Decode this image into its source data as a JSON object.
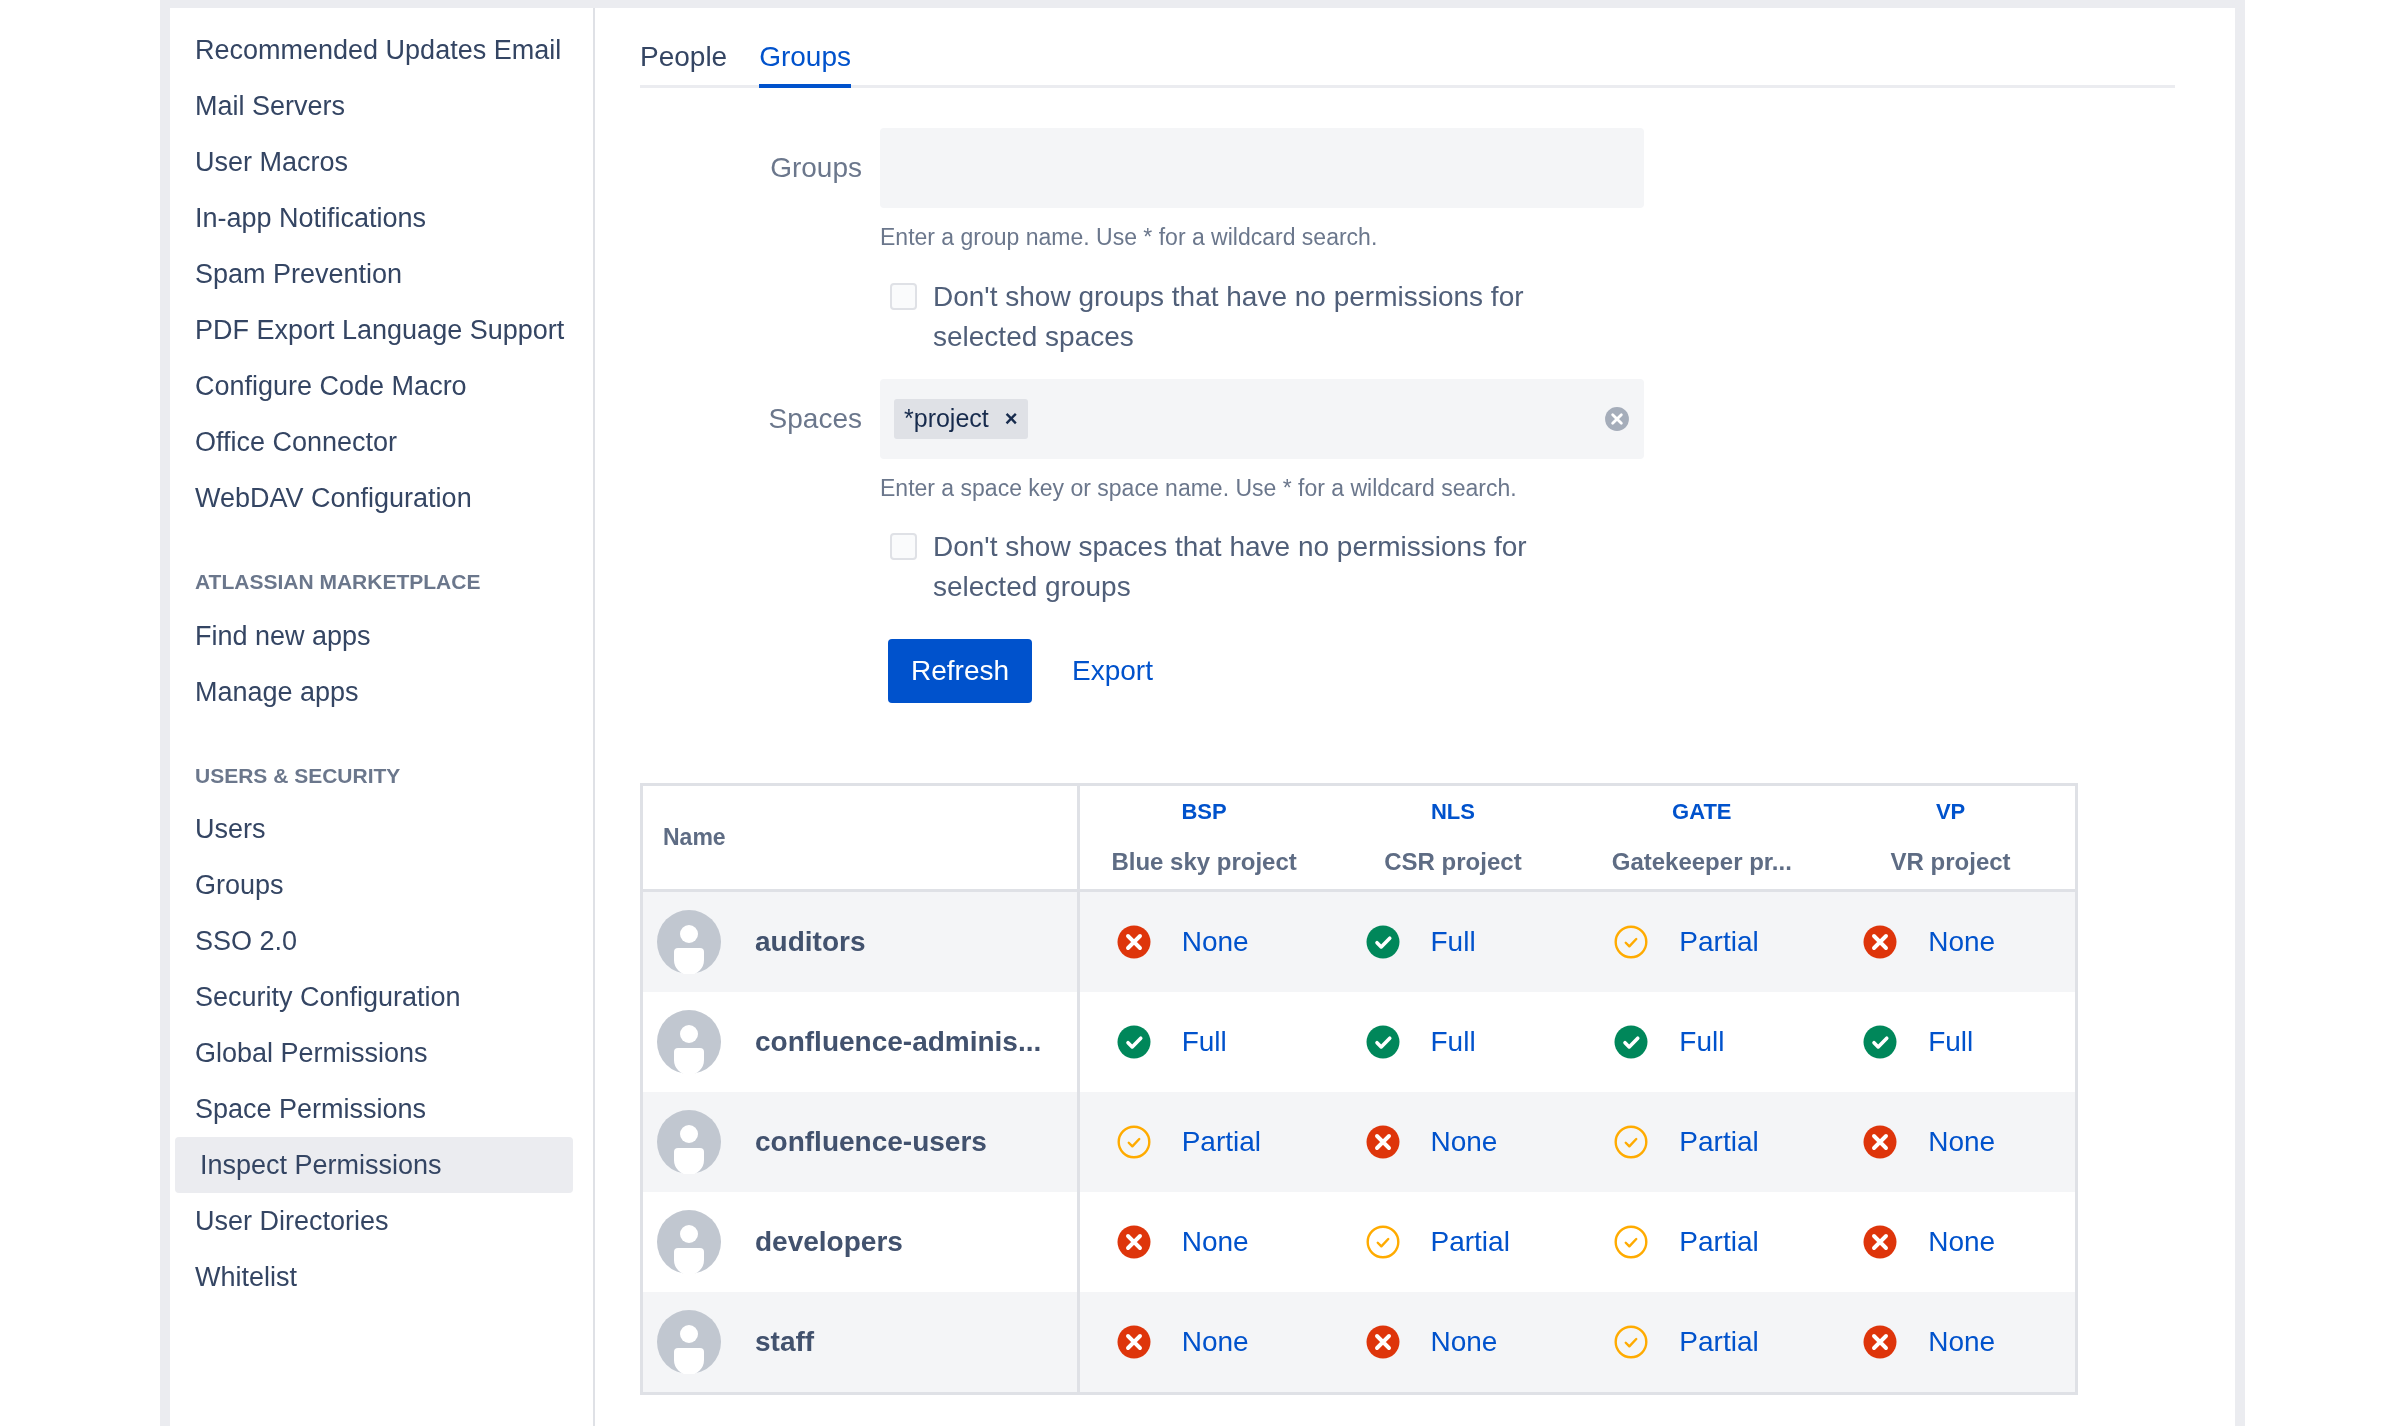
{
  "sidebar": {
    "sections": [
      {
        "items": [
          {
            "label": "Recommended Updates Email",
            "selected": false
          },
          {
            "label": "Mail Servers",
            "selected": false
          },
          {
            "label": "User Macros",
            "selected": false
          },
          {
            "label": "In-app Notifications",
            "selected": false
          },
          {
            "label": "Spam Prevention",
            "selected": false
          },
          {
            "label": "PDF Export Language Support",
            "selected": false
          },
          {
            "label": "Configure Code Macro",
            "selected": false
          },
          {
            "label": "Office Connector",
            "selected": false
          },
          {
            "label": "WebDAV Configuration",
            "selected": false
          }
        ]
      },
      {
        "heading": "ATLASSIAN MARKETPLACE",
        "items": [
          {
            "label": "Find new apps",
            "selected": false
          },
          {
            "label": "Manage apps",
            "selected": false
          }
        ]
      },
      {
        "heading": "USERS & SECURITY",
        "items": [
          {
            "label": "Users",
            "selected": false
          },
          {
            "label": "Groups",
            "selected": false
          },
          {
            "label": "SSO 2.0",
            "selected": false
          },
          {
            "label": "Security Configuration",
            "selected": false
          },
          {
            "label": "Global Permissions",
            "selected": false
          },
          {
            "label": "Space Permissions",
            "selected": false
          },
          {
            "label": "Inspect Permissions",
            "selected": true
          },
          {
            "label": "User Directories",
            "selected": false
          },
          {
            "label": "Whitelist",
            "selected": false
          }
        ]
      }
    ]
  },
  "tabs": [
    {
      "label": "People",
      "selected": false
    },
    {
      "label": "Groups",
      "selected": true
    }
  ],
  "form": {
    "groups": {
      "label": "Groups",
      "hint": "Enter a group name. Use * for a wildcard search.",
      "checkbox": {
        "label": "Don't show groups that have no permissions for selected spaces",
        "checked": false
      }
    },
    "spaces": {
      "label": "Spaces",
      "tags": [
        {
          "label": "*project",
          "remove": "×"
        }
      ],
      "hint": "Enter a space key or space name. Use * for a wildcard search.",
      "checkbox": {
        "label": "Don't show spaces that have no permissions for selected groups",
        "checked": false
      }
    },
    "buttons": {
      "primary": "Refresh",
      "link": "Export"
    }
  },
  "table": {
    "name_header": "Name",
    "columns": [
      {
        "key": "BSP",
        "name": "Blue sky project"
      },
      {
        "key": "NLS",
        "name": "CSR project"
      },
      {
        "key": "GATE",
        "name": "Gatekeeper pr..."
      },
      {
        "key": "VP",
        "name": "VR project"
      }
    ],
    "rows": [
      {
        "name": "auditors",
        "cells": [
          {
            "kind": "none",
            "label": "None"
          },
          {
            "kind": "full",
            "label": "Full"
          },
          {
            "kind": "partial",
            "label": "Partial"
          },
          {
            "kind": "none",
            "label": "None"
          }
        ]
      },
      {
        "name": "confluence-adminis...",
        "cells": [
          {
            "kind": "full",
            "label": "Full"
          },
          {
            "kind": "full",
            "label": "Full"
          },
          {
            "kind": "full",
            "label": "Full"
          },
          {
            "kind": "full",
            "label": "Full"
          }
        ]
      },
      {
        "name": "confluence-users",
        "cells": [
          {
            "kind": "partial",
            "label": "Partial"
          },
          {
            "kind": "none",
            "label": "None"
          },
          {
            "kind": "partial",
            "label": "Partial"
          },
          {
            "kind": "none",
            "label": "None"
          }
        ]
      },
      {
        "name": "developers",
        "cells": [
          {
            "kind": "none",
            "label": "None"
          },
          {
            "kind": "partial",
            "label": "Partial"
          },
          {
            "kind": "partial",
            "label": "Partial"
          },
          {
            "kind": "none",
            "label": "None"
          }
        ]
      },
      {
        "name": "staff",
        "cells": [
          {
            "kind": "none",
            "label": "None"
          },
          {
            "kind": "none",
            "label": "None"
          },
          {
            "kind": "partial",
            "label": "Partial"
          },
          {
            "kind": "none",
            "label": "None"
          }
        ]
      }
    ]
  }
}
